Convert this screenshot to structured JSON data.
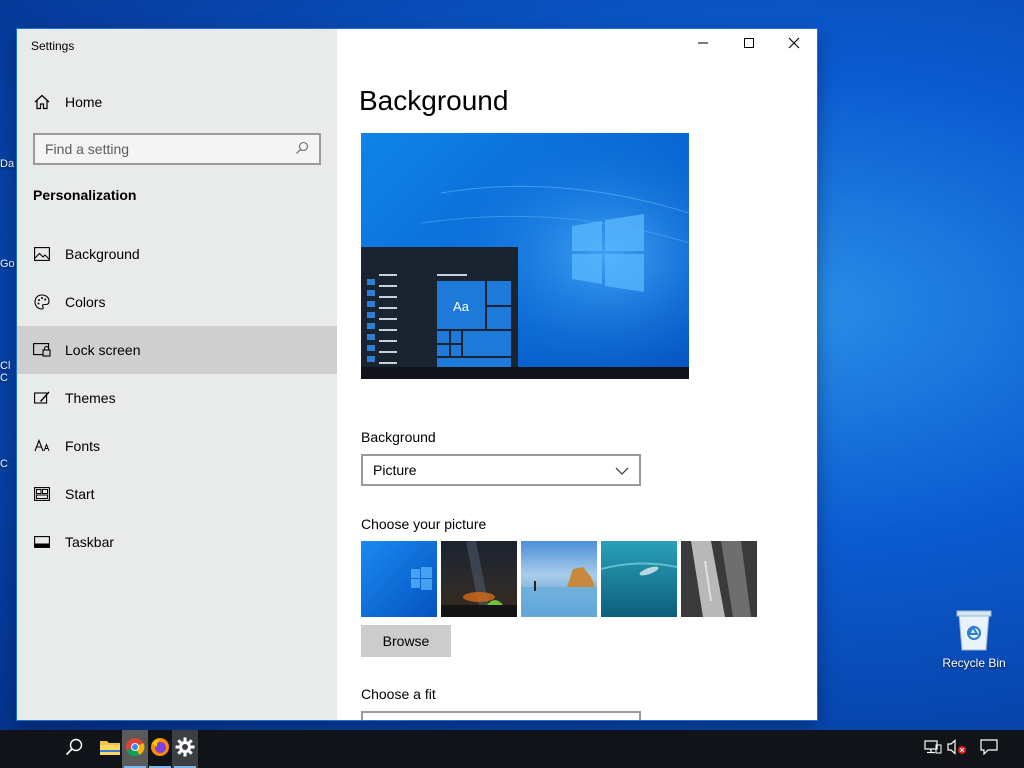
{
  "desktop": {
    "partial_labels": [
      "Da",
      "Go",
      "Cl",
      "C",
      "C"
    ],
    "recycle_bin_label": "Recycle Bin"
  },
  "window": {
    "app_title": "Settings",
    "minimize_icon": "minimize-icon",
    "maximize_icon": "maximize-icon",
    "close_icon": "close-icon"
  },
  "sidebar": {
    "home_label": "Home",
    "search_placeholder": "Find a setting",
    "section_title": "Personalization",
    "items": [
      {
        "label": "Background",
        "icon": "picture-icon",
        "active": false
      },
      {
        "label": "Colors",
        "icon": "palette-icon",
        "active": false
      },
      {
        "label": "Lock screen",
        "icon": "lock-screen-icon",
        "active": true
      },
      {
        "label": "Themes",
        "icon": "brush-icon",
        "active": false
      },
      {
        "label": "Fonts",
        "icon": "font-icon",
        "active": false
      },
      {
        "label": "Start",
        "icon": "start-icon",
        "active": false
      },
      {
        "label": "Taskbar",
        "icon": "taskbar-icon",
        "active": false
      }
    ]
  },
  "main": {
    "title": "Background",
    "preview_sample_text": "Aa",
    "background_label": "Background",
    "background_value": "Picture",
    "choose_picture_label": "Choose your picture",
    "browse_label": "Browse",
    "choose_fit_label": "Choose a fit"
  },
  "taskbar": {
    "icons": [
      "search-icon",
      "file-explorer-icon",
      "chrome-icon",
      "firefox-icon",
      "settings-icon"
    ],
    "tray_icons": [
      "network-icon",
      "volume-muted-icon",
      "action-center-icon"
    ]
  },
  "colors": {
    "accent": "#0078d7",
    "sidebar_bg": "#e9eaea",
    "active_item_bg": "#cfcfcf",
    "taskbar_bg": "#101418"
  }
}
